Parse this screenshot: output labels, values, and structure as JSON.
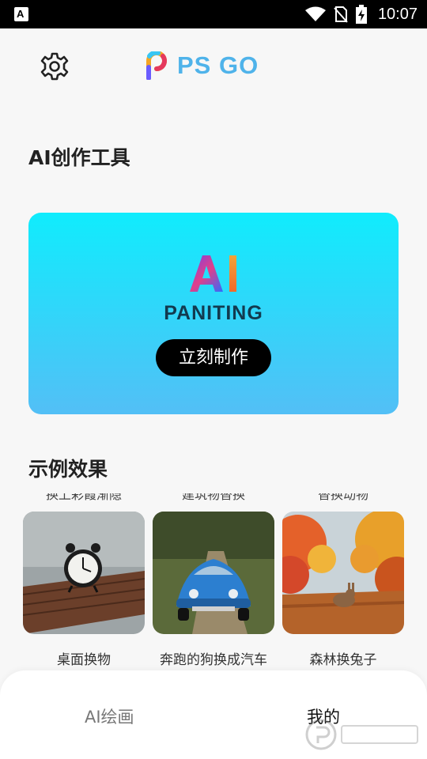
{
  "status_bar": {
    "time": "10:07"
  },
  "header": {
    "brand": "PS GO"
  },
  "sections": {
    "tools_title": "AI创作工具",
    "examples_title": "示例效果"
  },
  "hero": {
    "title": "AI",
    "subtitle": "PANITING",
    "button": "立刻制作"
  },
  "examples": {
    "cut_labels": [
      "换上彩霞渐隐",
      "建筑物替换",
      "替换动物"
    ],
    "items": [
      {
        "caption": "桌面换物"
      },
      {
        "caption": "奔跑的狗换成汽车"
      },
      {
        "caption": "森林换兔子"
      }
    ]
  },
  "bottom_nav": {
    "items": [
      "AI绘画",
      "我的"
    ]
  }
}
